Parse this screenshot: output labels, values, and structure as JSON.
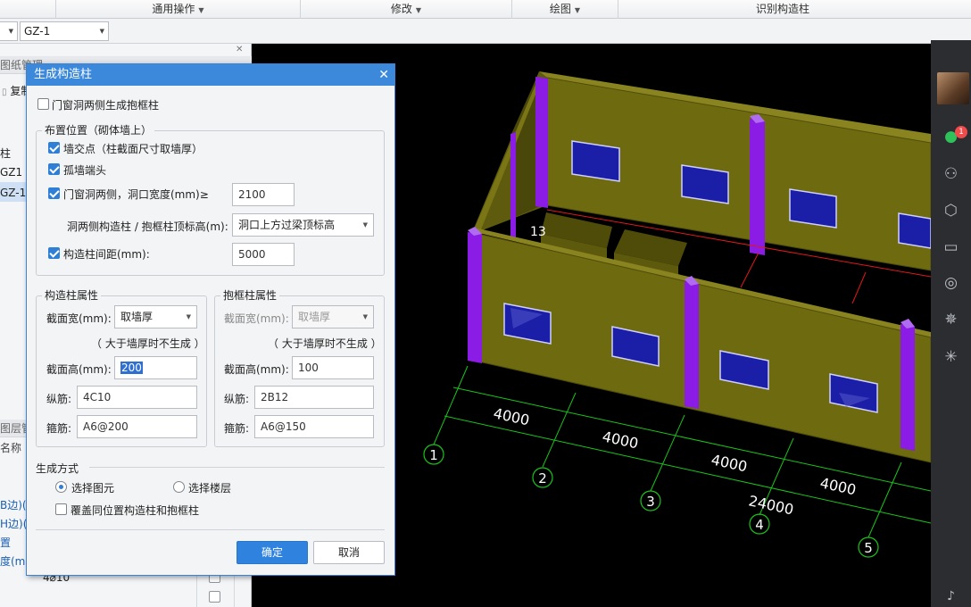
{
  "ribbon": {
    "groups": [
      "通用操作",
      "修改",
      "绘图",
      "识别构造柱"
    ]
  },
  "toolbar": {
    "combo1": "",
    "combo2": "GZ-1"
  },
  "left_panel": {
    "header1": "图纸管理",
    "copy": "复制",
    "item_zhu": "柱",
    "item_gz1a": "GZ1",
    "item_gz1b": "GZ-1",
    "header2": "图层管",
    "name_col": "名称",
    "prop1": "B边)(",
    "prop2": "H边)(",
    "prop3": "置",
    "prop4": "度(mm",
    "value_row": "4⌀10"
  },
  "dialog": {
    "title": "生成构造柱",
    "opt_door_window": "门窗洞两侧生成抱框柱",
    "placement_group": "布置位置（砌体墙上）",
    "wall_intersection": "墙交点（柱截面尺寸取墙厚）",
    "isolated_wall_end": "孤墙端头",
    "opening_sides": "门窗洞两侧，洞口宽度(mm)≥",
    "opening_width": "2100",
    "top_elevation_label": "洞两侧构造柱 / 抱框柱顶标高(m):",
    "top_elevation_value": "洞口上方过梁顶标高",
    "spacing_label": "构造柱间距(mm):",
    "spacing_value": "5000",
    "gz_props": {
      "title": "构造柱属性",
      "width_label": "截面宽(mm):",
      "width_value": "取墙厚",
      "note": "（ 大于墙厚时不生成 ）",
      "height_label": "截面高(mm):",
      "height_value": "200",
      "rebar_label": "纵筋:",
      "rebar_value": "4C10",
      "stirrup_label": "箍筋:",
      "stirrup_value": "A6@200"
    },
    "bk_props": {
      "title": "抱框柱属性",
      "width_label": "截面宽(mm):",
      "width_value": "取墙厚",
      "note": "（ 大于墙厚时不生成 ）",
      "height_label": "截面高(mm):",
      "height_value": "100",
      "rebar_label": "纵筋:",
      "rebar_value": "2B12",
      "stirrup_label": "箍筋:",
      "stirrup_value": "A6@150"
    },
    "gen_method": "生成方式",
    "select_element": "选择图元",
    "select_floor": "选择楼层",
    "overwrite": "覆盖同位置构造柱和抱框柱",
    "ok": "确定",
    "cancel": "取消"
  },
  "viewport": {
    "dims": [
      "4000",
      "4000",
      "4000",
      "4000",
      "24000"
    ],
    "axes": [
      "1",
      "2",
      "3",
      "4",
      "5"
    ],
    "partial_label": "13",
    "wall_color": "#6e6a10",
    "column_color": "#8a1ce6",
    "window_color": "#1b1fa8",
    "axis_color": "#19c419",
    "grid_color": "#e01818"
  },
  "sidebar": {
    "badge": "1",
    "icons": [
      "avatar",
      "chat-icon",
      "contacts-icon",
      "cube-icon",
      "folder-icon",
      "aperture-icon",
      "atom-icon",
      "sparkle-icon"
    ]
  }
}
